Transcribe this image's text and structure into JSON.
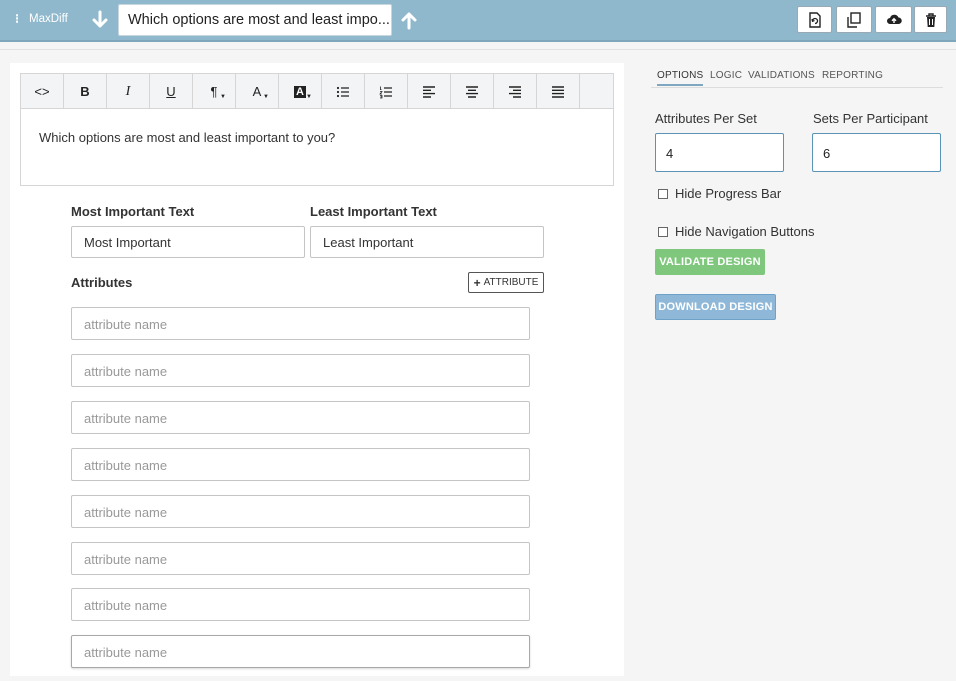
{
  "header": {
    "question_type": "MaxDiff",
    "question_title": "Which options are most and least impo...",
    "colors": {
      "bar": "#8fb8cd"
    },
    "tools": [
      {
        "name": "refresh-doc-button",
        "icon": "doc-refresh-icon"
      },
      {
        "name": "copy-button",
        "icon": "copy-icon"
      },
      {
        "name": "upload-button",
        "icon": "cloud-upload-icon"
      },
      {
        "name": "delete-button",
        "icon": "trash-icon"
      }
    ]
  },
  "editor": {
    "toolbar": [
      {
        "name": "code-view-button",
        "label": "<>"
      },
      {
        "name": "bold-button",
        "label": "B"
      },
      {
        "name": "italic-button",
        "label": "I"
      },
      {
        "name": "underline-button",
        "label": "U"
      },
      {
        "name": "paragraph-button",
        "label": "¶"
      },
      {
        "name": "text-color-button",
        "label": "A"
      },
      {
        "name": "background-color-button",
        "label": "A"
      },
      {
        "name": "bullet-list-button",
        "label": ""
      },
      {
        "name": "numbered-list-button",
        "label": ""
      },
      {
        "name": "align-left-button",
        "label": ""
      },
      {
        "name": "align-center-button",
        "label": ""
      },
      {
        "name": "align-right-button",
        "label": ""
      },
      {
        "name": "justify-button",
        "label": ""
      }
    ],
    "content": "Which options are most and least important to you?"
  },
  "form": {
    "most_label": "Most Important Text",
    "most_value": "Most Important",
    "least_label": "Least Important Text",
    "least_value": "Least Important",
    "attributes_label": "Attributes",
    "add_attribute_label": "ATTRIBUTE",
    "attribute_placeholder": "attribute name"
  },
  "options": {
    "tabs": [
      "OPTIONS",
      "LOGIC",
      "VALIDATIONS",
      "REPORTING"
    ],
    "active_tab": "OPTIONS",
    "attributes_per_set_label": "Attributes Per Set",
    "attributes_per_set_value": "4",
    "sets_per_participant_label": "Sets Per Participant",
    "sets_per_participant_value": "6",
    "hide_progress_bar_label": "Hide Progress Bar",
    "hide_navigation_label": "Hide Navigation Buttons",
    "validate_label": "VALIDATE DESIGN",
    "download_label": "DOWNLOAD DESIGN",
    "colors": {
      "validate": "#7fc77d",
      "download": "#8fb8d8"
    }
  }
}
